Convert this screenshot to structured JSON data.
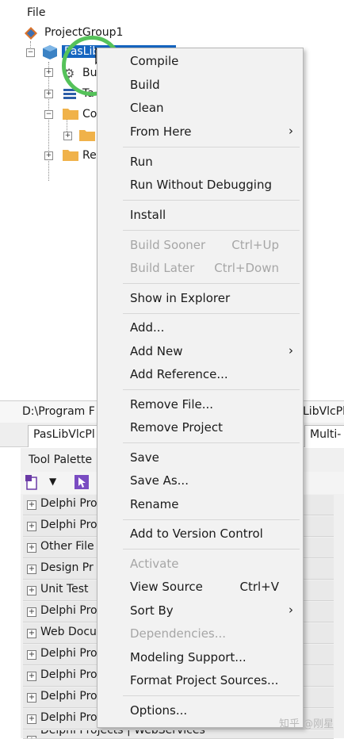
{
  "menubar": {
    "file": "File"
  },
  "tree": {
    "project_group": "ProjectGroup1",
    "project": "PasLib",
    "child_build": "Bu",
    "child_target": "Ta",
    "child_contains": "Co",
    "child_requires": "Re"
  },
  "lower": {
    "path": "D:\\Program F",
    "path_right": "LibVlcPl",
    "tab_left": "PasLibVlcPl",
    "tab_right": "Multi-",
    "tool_palette_title": "Tool Palette",
    "palette_items": [
      "Delphi Pro",
      "Delphi Pro",
      "Other File",
      "Design Pr",
      "Unit Test",
      "Delphi Pro",
      "Web Docu",
      "Delphi Pro",
      "Delphi Pro",
      "Delphi Pro",
      "Delphi Pro",
      "Delphi Projects | WebServices"
    ]
  },
  "context_menu": {
    "items": [
      {
        "label": "Compile",
        "shortcut": "",
        "submenu": false,
        "disabled": false
      },
      {
        "label": "Build",
        "shortcut": "",
        "submenu": false,
        "disabled": false
      },
      {
        "label": "Clean",
        "shortcut": "",
        "submenu": false,
        "disabled": false
      },
      {
        "label": "From Here",
        "shortcut": "",
        "submenu": true,
        "disabled": false
      },
      {
        "label": "Run",
        "shortcut": "",
        "submenu": false,
        "disabled": false
      },
      {
        "label": "Run Without Debugging",
        "shortcut": "",
        "submenu": false,
        "disabled": false
      },
      {
        "label": "Install",
        "shortcut": "",
        "submenu": false,
        "disabled": false
      },
      {
        "label": "Build Sooner",
        "shortcut": "Ctrl+Up",
        "submenu": false,
        "disabled": true
      },
      {
        "label": "Build Later",
        "shortcut": "Ctrl+Down",
        "submenu": false,
        "disabled": true
      },
      {
        "label": "Show in Explorer",
        "shortcut": "",
        "submenu": false,
        "disabled": false
      },
      {
        "label": "Add...",
        "shortcut": "",
        "submenu": false,
        "disabled": false
      },
      {
        "label": "Add New",
        "shortcut": "",
        "submenu": true,
        "disabled": false
      },
      {
        "label": "Add Reference...",
        "shortcut": "",
        "submenu": false,
        "disabled": false
      },
      {
        "label": "Remove File...",
        "shortcut": "",
        "submenu": false,
        "disabled": false
      },
      {
        "label": "Remove Project",
        "shortcut": "",
        "submenu": false,
        "disabled": false
      },
      {
        "label": "Save",
        "shortcut": "",
        "submenu": false,
        "disabled": false
      },
      {
        "label": "Save As...",
        "shortcut": "",
        "submenu": false,
        "disabled": false
      },
      {
        "label": "Rename",
        "shortcut": "",
        "submenu": false,
        "disabled": false
      },
      {
        "label": "Add to Version Control",
        "shortcut": "",
        "submenu": false,
        "disabled": false
      },
      {
        "label": "Activate",
        "shortcut": "",
        "submenu": false,
        "disabled": true
      },
      {
        "label": "View Source",
        "shortcut": "Ctrl+V",
        "submenu": false,
        "disabled": false
      },
      {
        "label": "Sort By",
        "shortcut": "",
        "submenu": true,
        "disabled": false
      },
      {
        "label": "Dependencies...",
        "shortcut": "",
        "submenu": false,
        "disabled": true
      },
      {
        "label": "Modeling Support...",
        "shortcut": "",
        "submenu": false,
        "disabled": false
      },
      {
        "label": "Format Project Sources...",
        "shortcut": "",
        "submenu": false,
        "disabled": false
      },
      {
        "label": "Options...",
        "shortcut": "",
        "submenu": false,
        "disabled": false
      }
    ],
    "submenu_arrow": "›"
  },
  "watermark": "知乎 @刚星",
  "colors": {
    "selection": "#1565c0",
    "highlight_ring": "#55c25a",
    "menu_bg": "#f2f2f2",
    "disabled_text": "#a6a6a6"
  }
}
